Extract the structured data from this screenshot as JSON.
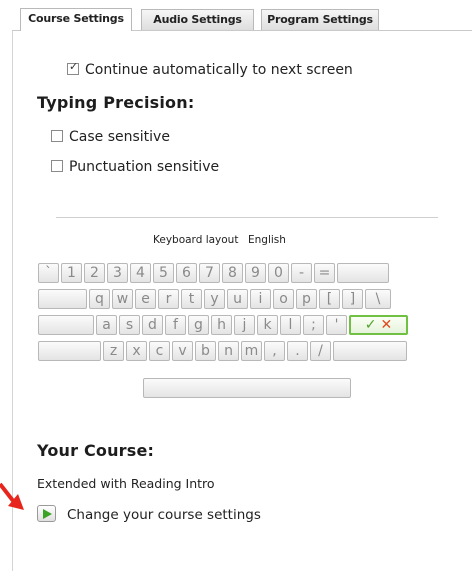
{
  "tabs": [
    {
      "label": "Course Settings"
    },
    {
      "label": "Audio Settings"
    },
    {
      "label": "Program Settings"
    }
  ],
  "options": {
    "continue_auto": {
      "label": "Continue automatically to next screen",
      "checked": true
    }
  },
  "typing": {
    "heading": "Typing Precision:",
    "case": {
      "label": "Case sensitive",
      "checked": false
    },
    "punct": {
      "label": "Punctuation sensitive",
      "checked": false
    }
  },
  "keyboard": {
    "layout_label": "Keyboard layout",
    "layout_value": "English",
    "rows": [
      [
        "`",
        "1",
        "2",
        "3",
        "4",
        "5",
        "6",
        "7",
        "8",
        "9",
        "0",
        "-",
        "=",
        ""
      ],
      [
        "",
        "q",
        "w",
        "e",
        "r",
        "t",
        "y",
        "u",
        "i",
        "o",
        "p",
        "[",
        "]",
        "\\"
      ],
      [
        "",
        "a",
        "s",
        "d",
        "f",
        "g",
        "h",
        "j",
        "k",
        "l",
        ";",
        "'",
        ""
      ],
      [
        "",
        "z",
        "x",
        "c",
        "v",
        "b",
        "n",
        "m",
        ",",
        ".",
        "/",
        ""
      ],
      [
        ""
      ]
    ],
    "enter_icons": [
      "check-icon",
      "cross-icon"
    ],
    "enter_symbols": {
      "check": "✓",
      "cross": "✕"
    },
    "colors": {
      "check": "#4fa22a",
      "cross": "#e04a1e",
      "enter_border": "#6fc043"
    }
  },
  "course": {
    "heading": "Your Course:",
    "value": "Extended with Reading Intro",
    "change_label": "Change your course settings"
  },
  "colors": {
    "accent_green": "#3aa225",
    "arrow_red": "#e8251c"
  }
}
